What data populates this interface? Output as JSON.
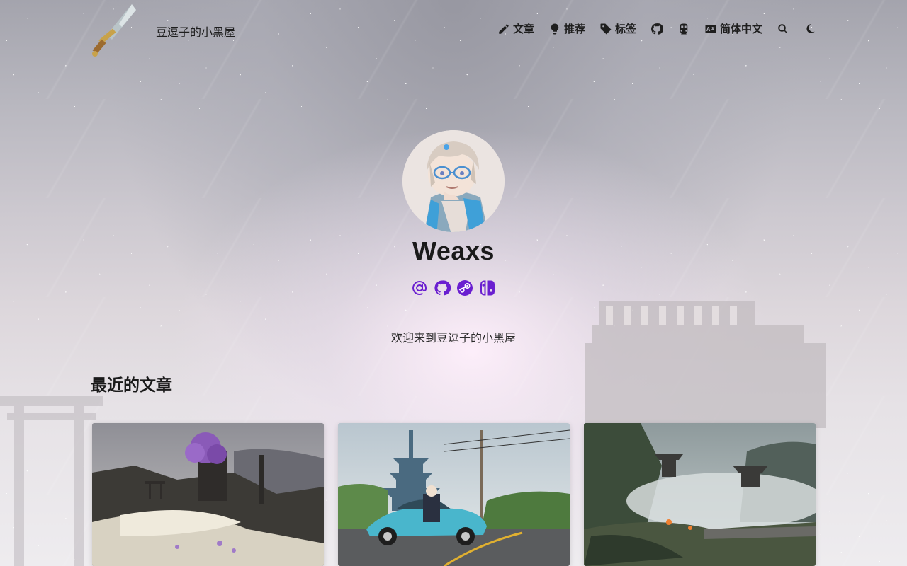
{
  "site": {
    "title": "豆逗子的小黑屋",
    "logo_icon": "sword-icon"
  },
  "nav": {
    "items": [
      {
        "label": "文章",
        "icon": "pencil-icon"
      },
      {
        "label": "推荐",
        "icon": "lightbulb-icon"
      },
      {
        "label": "标签",
        "icon": "tag-icon"
      },
      {
        "label": "",
        "icon": "github-icon"
      },
      {
        "label": "",
        "icon": "train-icon"
      },
      {
        "label": "简体中文",
        "icon": "language-icon"
      },
      {
        "label": "",
        "icon": "search-icon"
      },
      {
        "label": "",
        "icon": "moon-icon"
      }
    ]
  },
  "profile": {
    "name": "Weaxs",
    "welcome": "欢迎来到豆逗子的小黑屋",
    "socials": [
      "email-icon",
      "github-icon",
      "steam-icon",
      "nintendo-switch-icon"
    ],
    "accent_color": "#6a1fd0"
  },
  "recent": {
    "title": "最近的文章",
    "cards": [
      {
        "image": "ruined-shrine-with-purple-tree"
      },
      {
        "image": "pagoda-and-blue-sports-car"
      },
      {
        "image": "misty-mountain-temple"
      }
    ]
  }
}
